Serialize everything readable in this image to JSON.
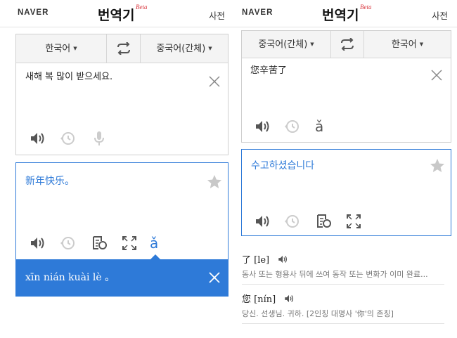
{
  "colors": {
    "accent": "#2e7ad8",
    "beta": "#d9363e",
    "icon_gray": "#555555",
    "icon_disabled": "#cccccc"
  },
  "left": {
    "header": {
      "brand": "NAVER",
      "title": "번역기",
      "beta": "Beta",
      "dict_link": "사전"
    },
    "lang_bar": {
      "source": "한국어",
      "target": "중국어(간체)"
    },
    "input": {
      "text": "새해 복 많이 받으세요."
    },
    "output": {
      "text": "新年快乐。",
      "pinyin_button": "ǎ"
    },
    "pinyin": {
      "text": "xīn nián kuài lè 。"
    }
  },
  "right": {
    "header": {
      "brand": "NAVER",
      "title": "번역기",
      "beta": "Beta",
      "dict_link": "사전"
    },
    "lang_bar": {
      "source": "중국어(간체)",
      "target": "한국어"
    },
    "input": {
      "text": "您辛苦了",
      "pinyin_button": "ǎ"
    },
    "output": {
      "text": "수고하셨습니다"
    },
    "dictionary": [
      {
        "word": "了 [le]",
        "definition": "동사 또는 형용사 뒤에 쓰여 동작 또는 변화가 이미 완료..."
      },
      {
        "word": "您 [nín]",
        "definition": "당신. 선생님. 귀하. [2인칭 대명사 '你'의 존칭]"
      }
    ]
  }
}
